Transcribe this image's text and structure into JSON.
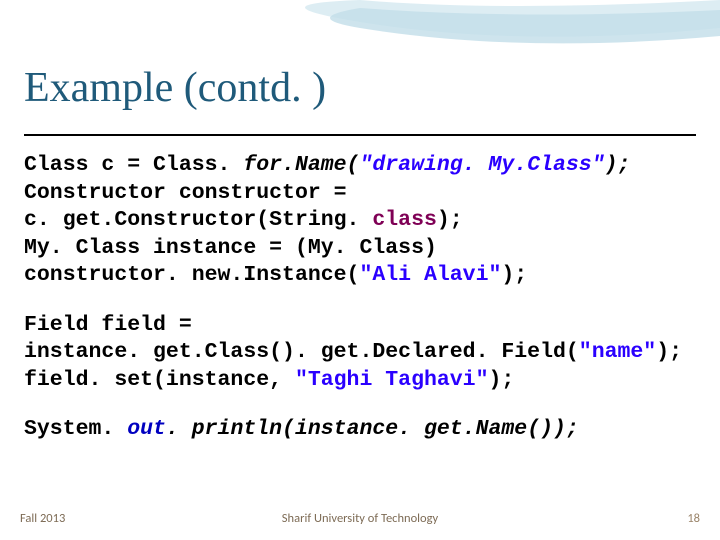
{
  "title": "Example (contd. )",
  "code": {
    "l1a": "Class c = Class. ",
    "l1b": "for.Name(",
    "l1c": "\"drawing. My.Class\"",
    "l1d": ");",
    "l2": "Constructor constructor =",
    "l3a": "  c. get.Constructor(String. ",
    "l3b": "class",
    "l3c": ");",
    "l4": "My. Class instance = (My. Class)",
    "l5a": "  constructor. new.Instance(",
    "l5b": "\"Ali Alavi\"",
    "l5c": ");",
    "l6": "Field field =",
    "l7a": "  instance. get.Class(). get.Declared. Field(",
    "l7b": "\"name\"",
    "l7c": ");",
    "l8a": "field. set(instance, ",
    "l8b": "\"Taghi Taghavi\"",
    "l8c": ");",
    "l9a": "System. ",
    "l9b": "out",
    "l9c": ". println(instance. get.Name());"
  },
  "footer": {
    "left": "Fall 2013",
    "center": "Sharif University of Technology",
    "right": "18"
  }
}
